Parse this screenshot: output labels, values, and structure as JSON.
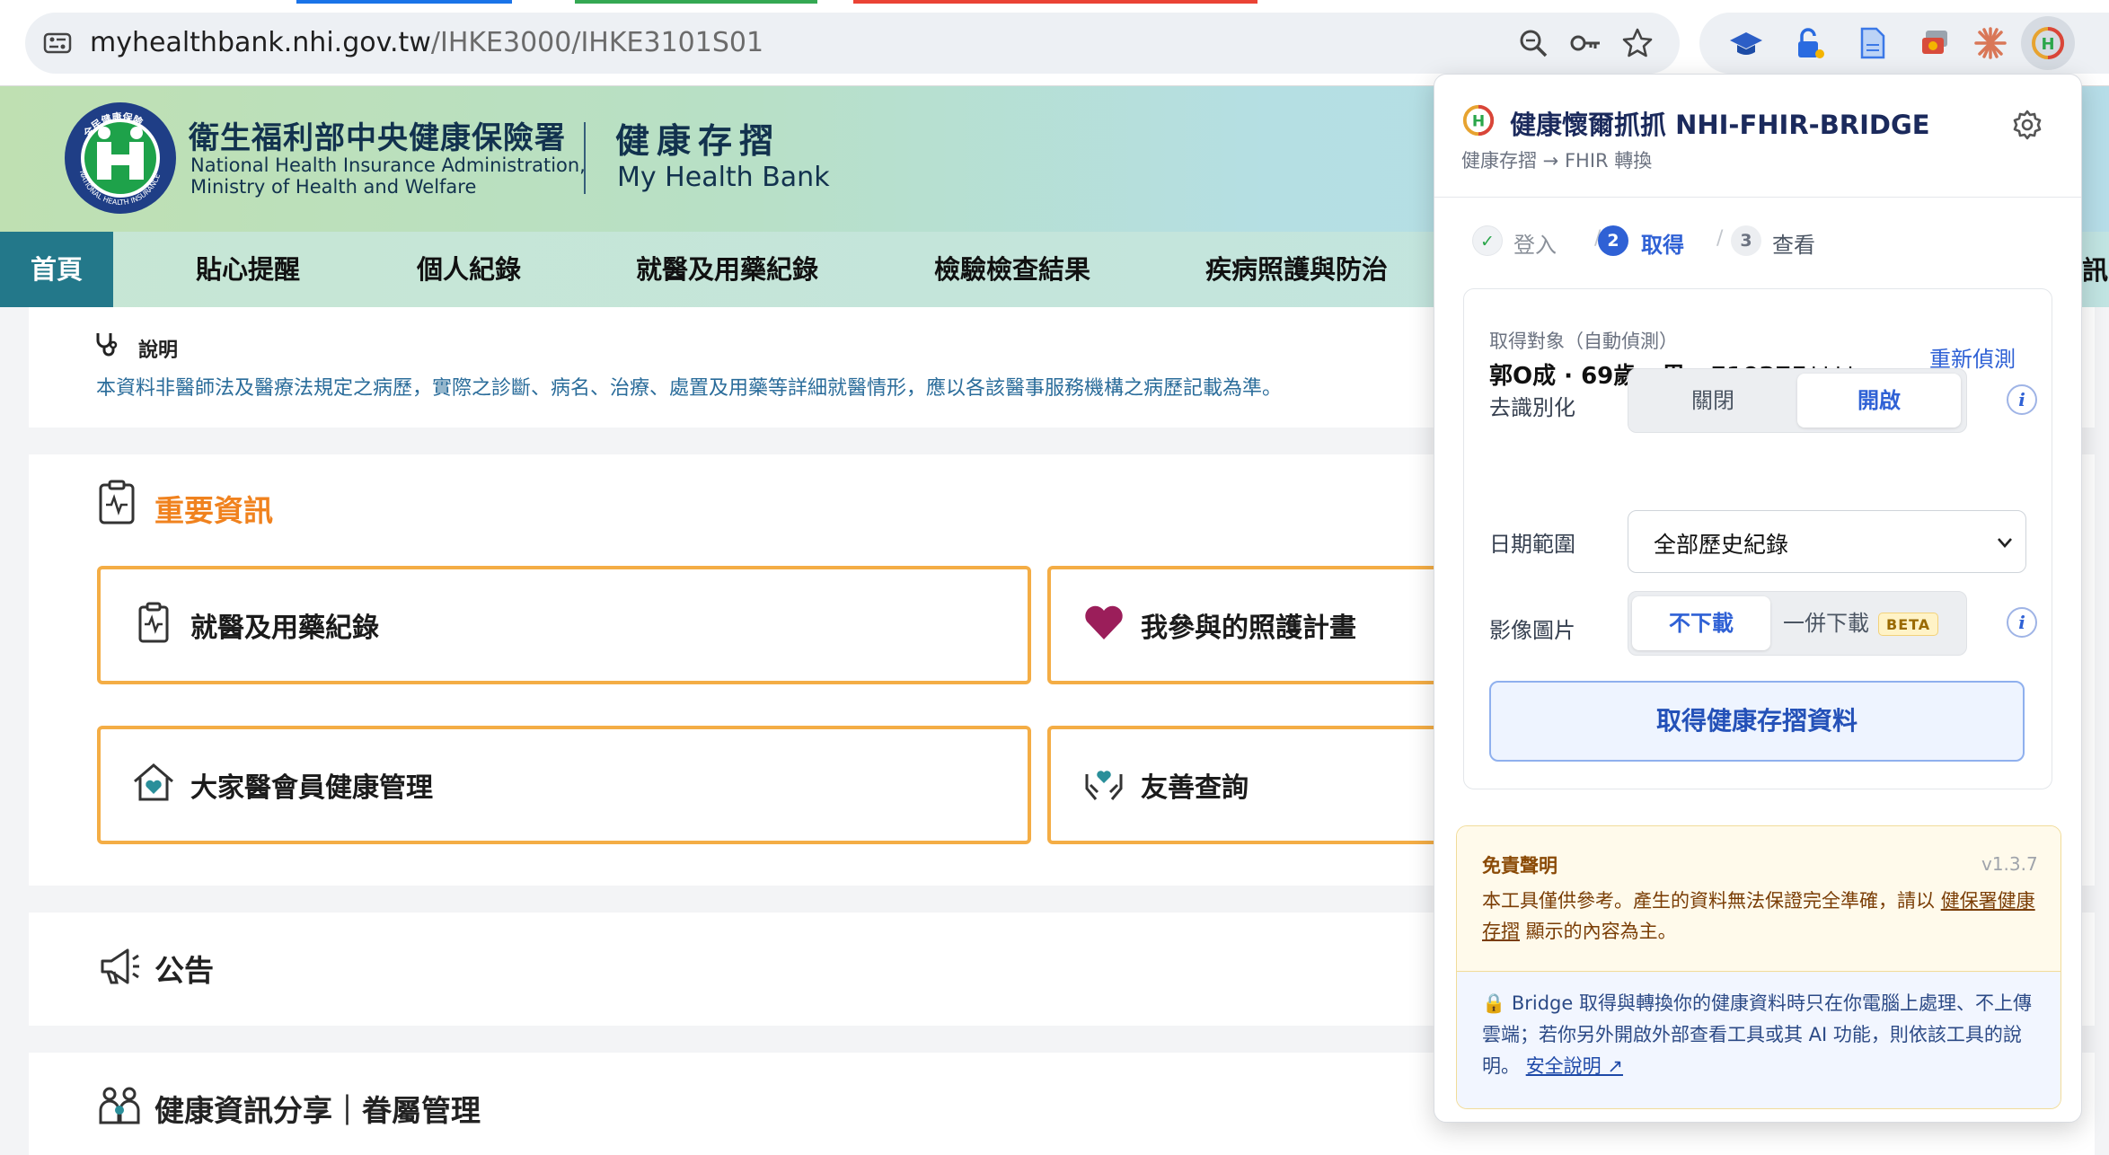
{
  "browser": {
    "url_host": "myhealthbank.nhi.gov.tw",
    "url_path": "/IHKE3000/IHKE3101S01",
    "tab_colors": [
      "#1a73e8",
      "#34a853",
      "#ea4335"
    ],
    "extensions": [
      "mortarboard-icon",
      "unlock-icon",
      "document-icon",
      "cards-icon",
      "claude-icon",
      "nhi-fhir-bridge-icon"
    ]
  },
  "site": {
    "org_zh": "衛生福利部中央健康保險署",
    "org_en_1": "National Health Insurance Administration,",
    "org_en_2": "Ministry of Health and Welfare",
    "product_zh": "健康存摺",
    "product_en": "My Health Bank",
    "logo_text": "全民健康保險 NATIONAL HEALTH INSURANCE"
  },
  "nav": {
    "items": [
      "首頁",
      "貼心提醒",
      "個人紀錄",
      "就醫及用藥紀錄",
      "檢驗檢查結果",
      "疾病照護與防治"
    ],
    "tail": "訊"
  },
  "note": {
    "title": "說明",
    "text": "本資料非醫師法及醫療法規定之病歷，實際之診斷、病名、治療、處置及用藥等詳細就醫情形，應以各該醫事服務機構之病歷記載為準。"
  },
  "important": {
    "title": "重要資訊",
    "cards": [
      "就醫及用藥紀錄",
      "我參與的照護計畫",
      "大家醫會員健康管理",
      "友善查詢"
    ]
  },
  "announce": {
    "title": "公告"
  },
  "share": {
    "title": "健康資訊分享｜眷屬管理"
  },
  "popup": {
    "title": "健康懷爾抓抓 NHI-FHIR-BRIDGE",
    "subtitle": "健康存摺 → FHIR 轉換",
    "steps": [
      {
        "num": "✓",
        "label": "登入",
        "state": "done"
      },
      {
        "num": "2",
        "label": "取得",
        "state": "active"
      },
      {
        "num": "3",
        "label": "查看",
        "state": "todo"
      }
    ],
    "target_caption": "取得對象（自動偵測）",
    "target_value": "郭O成 · 69歲 · 男 · F10375****",
    "redetect": "重新偵測",
    "deid": {
      "label": "去識別化",
      "off": "關閉",
      "on": "開啟",
      "selected": "開啟"
    },
    "date_range": {
      "label": "日期範圍",
      "value": "全部歷史紀錄"
    },
    "images": {
      "label": "影像圖片",
      "opt1": "不下載",
      "opt2": "一併下載",
      "badge": "BETA",
      "selected": "不下載"
    },
    "fetch_button": "取得健康存摺資料",
    "disclaimer": {
      "title": "免責聲明",
      "version": "v1.3.7",
      "text_before": "本工具僅供參考。產生的資料無法保證完全準確，請以 ",
      "link": "健保署健康存摺",
      "text_after": " 顯示的內容為主。"
    },
    "privacy": {
      "text": "🔒 Bridge 取得與轉換你的健康資料時只在你電腦上處理、不上傳雲端；若你另外開啟外部查看工具或其 AI 功能，則依該工具的說明。",
      "link": "安全說明 ↗"
    },
    "colors": {
      "accent": "#2f61d5",
      "title": "#1b2a5c",
      "warning": "#8a4a06"
    }
  }
}
